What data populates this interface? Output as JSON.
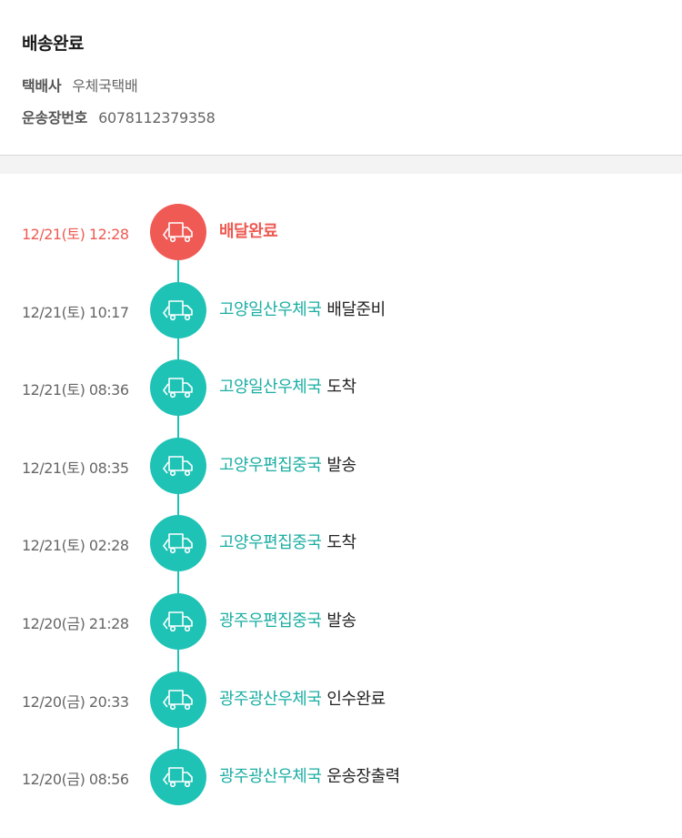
{
  "summary": {
    "status_title": "배송완료",
    "carrier_label": "택배사",
    "carrier_value": "우체국택배",
    "tracking_label": "운송장번호",
    "tracking_value": "6078112379358"
  },
  "colors": {
    "accent_teal": "#1fc3b6",
    "location_text": "#1aaea3",
    "highlight_red": "#f05a55",
    "time_red": "#ee5a52"
  },
  "icon": "delivery-truck-icon",
  "events": [
    {
      "time": "12/21(토) 12:28",
      "location": "",
      "status": "배달완료"
    },
    {
      "time": "12/21(토) 10:17",
      "location": "고양일산우체국",
      "status": "배달준비"
    },
    {
      "time": "12/21(토) 08:36",
      "location": "고양일산우체국",
      "status": "도착"
    },
    {
      "time": "12/21(토) 08:35",
      "location": "고양우편집중국",
      "status": "발송"
    },
    {
      "time": "12/21(토) 02:28",
      "location": "고양우편집중국",
      "status": "도착"
    },
    {
      "time": "12/20(금) 21:28",
      "location": "광주우편집중국",
      "status": "발송"
    },
    {
      "time": "12/20(금) 20:33",
      "location": "광주광산우체국",
      "status": "인수완료"
    },
    {
      "time": "12/20(금) 08:56",
      "location": "광주광산우체국",
      "status": "운송장출력"
    }
  ]
}
